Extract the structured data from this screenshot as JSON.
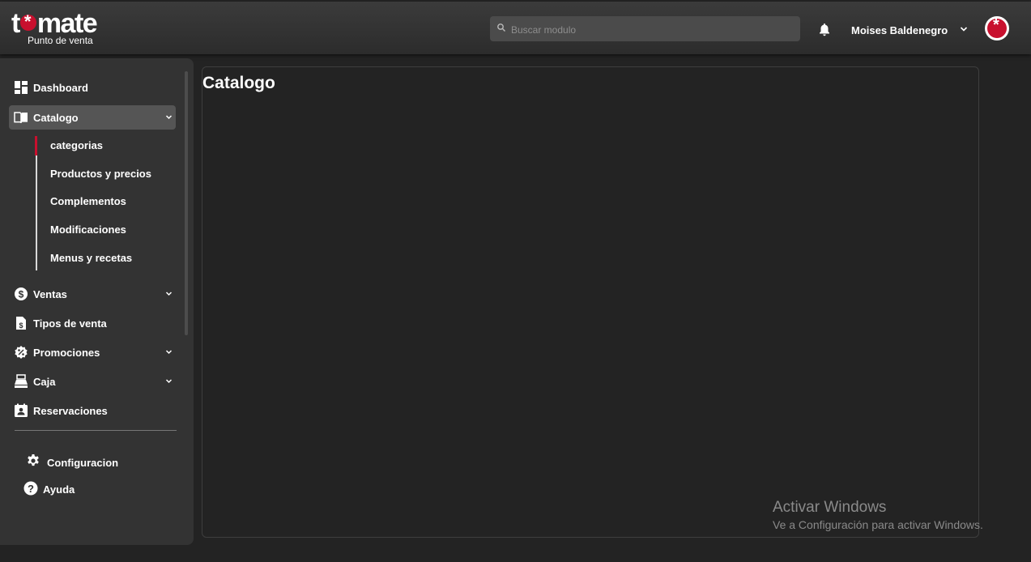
{
  "brand": {
    "name": "tomate",
    "name_before": "t",
    "name_after": "mate",
    "tagline": "Punto de venta"
  },
  "header": {
    "search_placeholder": "Buscar modulo",
    "user_name": "Moises Baldenegro"
  },
  "sidebar": {
    "items": [
      {
        "label": "Dashboard",
        "icon": "dashboard-icon"
      },
      {
        "label": "Catalogo",
        "icon": "book-icon",
        "expanded": true
      },
      {
        "label": "Ventas",
        "icon": "dollar-icon"
      },
      {
        "label": "Tipos de venta",
        "icon": "receipt-icon"
      },
      {
        "label": "Promociones",
        "icon": "discount-icon"
      },
      {
        "label": "Caja",
        "icon": "cash-register-icon"
      },
      {
        "label": "Reservaciones",
        "icon": "reservation-icon"
      }
    ],
    "catalogo_sub": [
      "categorias",
      "Productos y precios",
      "Complementos",
      "Modificaciones",
      "Menus y recetas"
    ],
    "bottom": [
      {
        "label": "Configuracion",
        "icon": "gear-icon"
      },
      {
        "label": "Ayuda",
        "icon": "help-icon"
      }
    ]
  },
  "main": {
    "title": "Catalogo"
  },
  "watermark": {
    "line1": "Activar Windows",
    "line2": "Ve a Configuración para activar Windows."
  },
  "colors": {
    "accent": "#c8102e",
    "background": "#232323",
    "sidebar": "#333333"
  }
}
